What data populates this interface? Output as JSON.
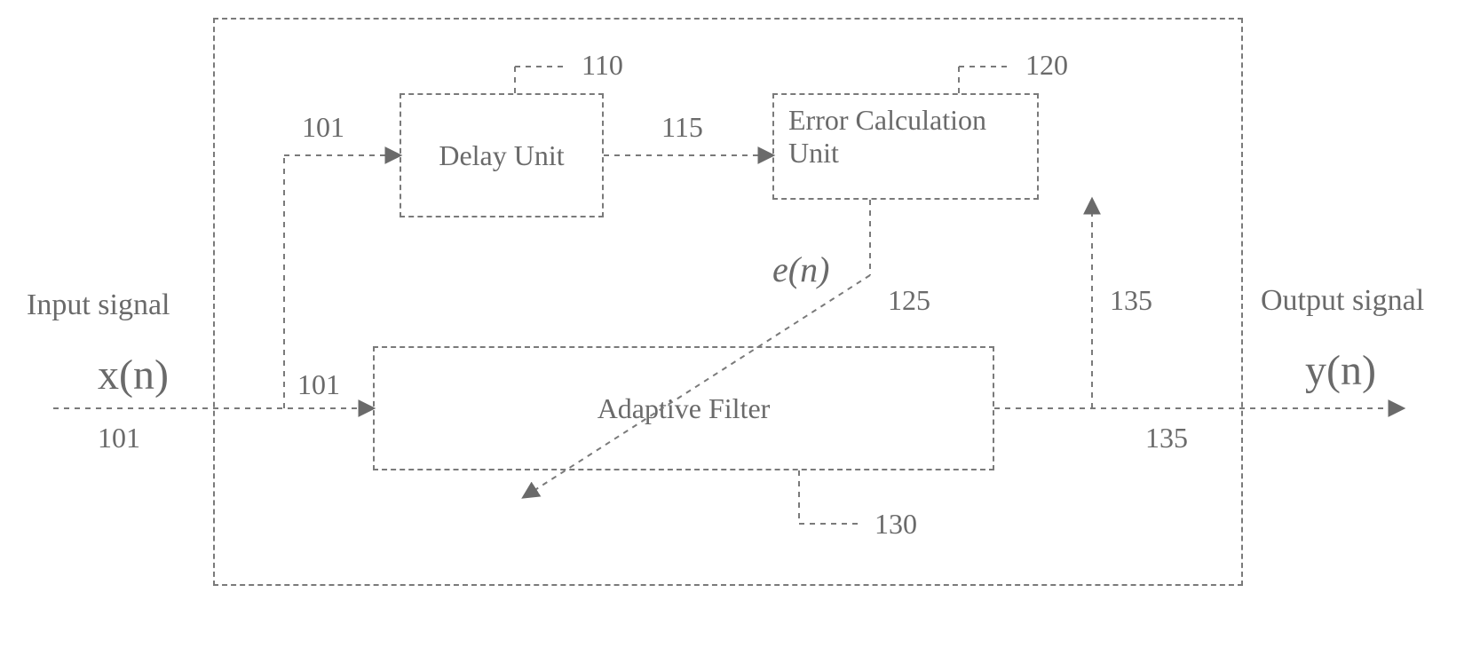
{
  "labels": {
    "input_signal_title": "Input signal",
    "input_signal_symbol": "x(n)",
    "output_signal_title": "Output signal",
    "output_signal_symbol": "y(n)",
    "error_symbol": "e(n)",
    "ref_101_a": "101",
    "ref_101_b": "101",
    "ref_101_c": "101",
    "ref_110": "110",
    "ref_115": "115",
    "ref_120": "120",
    "ref_125": "125",
    "ref_130": "130",
    "ref_135_a": "135",
    "ref_135_b": "135"
  },
  "blocks": {
    "delay_unit": "Delay Unit",
    "error_calc_unit": "Error Calculation Unit",
    "adaptive_filter": "Adaptive Filter"
  },
  "colors": {
    "line": "#7a7a7a"
  }
}
